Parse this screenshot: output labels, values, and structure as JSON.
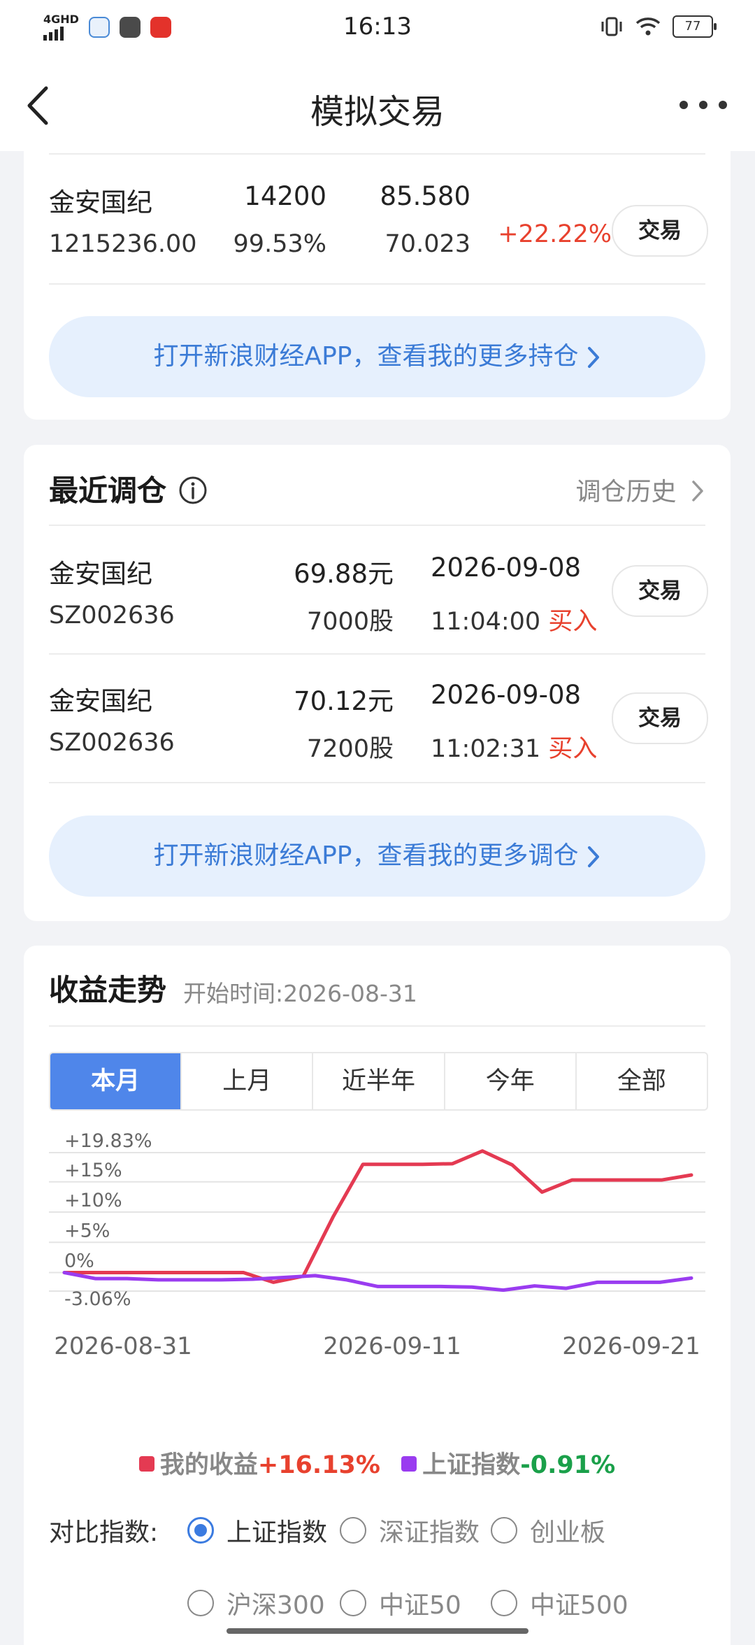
{
  "status_bar": {
    "network": "4GHD",
    "time": "16:13",
    "battery": "77"
  },
  "nav": {
    "title": "模拟交易"
  },
  "holding": {
    "name": "金安国纪",
    "quantity": "14200",
    "price": "85.580",
    "value": "1215236.00",
    "ratio": "99.53%",
    "cost": "70.023",
    "gain": "+22.22%",
    "trade_label": "交易"
  },
  "promo_positions": "打开新浪财经APP，查看我的更多持仓",
  "recent": {
    "title": "最近调仓",
    "history_link": "调仓历史",
    "items": [
      {
        "name": "金安国纪",
        "code": "SZ002636",
        "price": "69.88元",
        "shares": "7000股",
        "date": "2026-09-08",
        "time": "11:04:00",
        "action": "买入",
        "trade_label": "交易"
      },
      {
        "name": "金安国纪",
        "code": "SZ002636",
        "price": "70.12元",
        "shares": "7200股",
        "date": "2026-09-08",
        "time": "11:02:31",
        "action": "买入",
        "trade_label": "交易"
      }
    ]
  },
  "promo_trades": "打开新浪财经APP，查看我的更多调仓",
  "earnings": {
    "title": "收益走势",
    "start": "开始时间:2026-08-31",
    "tabs": [
      "本月",
      "上月",
      "近半年",
      "今年",
      "全部"
    ],
    "active_tab": 0
  },
  "chart_data": {
    "type": "line",
    "y_tick_labels": [
      "+19.83%",
      "+15%",
      "+10%",
      "+5%",
      "0%",
      "-3.06%"
    ],
    "ylim": [
      -3.06,
      19.83
    ],
    "x_tick_labels": [
      "2026-08-31",
      "2026-09-11",
      "2026-09-21"
    ],
    "series": [
      {
        "name": "我的收益",
        "color": "#e43a52",
        "summary": "+16.13%",
        "values": [
          0,
          0,
          0,
          0,
          0,
          0,
          0,
          -1.6,
          -0.6,
          9.2,
          17.9,
          17.9,
          17.9,
          18.0,
          20.1,
          17.8,
          13.3,
          15.3,
          15.3,
          15.3,
          15.3,
          16.13
        ]
      },
      {
        "name": "上证指数",
        "color": "#9a3cf0",
        "summary": "-0.91%",
        "values": [
          0,
          -1.0,
          -1.0,
          -1.2,
          -1.2,
          -1.2,
          -1.1,
          -0.8,
          -0.5,
          -1.2,
          -2.3,
          -2.3,
          -2.3,
          -2.4,
          -2.9,
          -2.2,
          -2.6,
          -1.6,
          -1.6,
          -1.6,
          -0.91
        ]
      }
    ]
  },
  "compare": {
    "label": "对比指数:",
    "options": [
      "上证指数",
      "深证指数",
      "创业板",
      "沪深300",
      "中证50",
      "中证500"
    ],
    "selected": 0
  }
}
